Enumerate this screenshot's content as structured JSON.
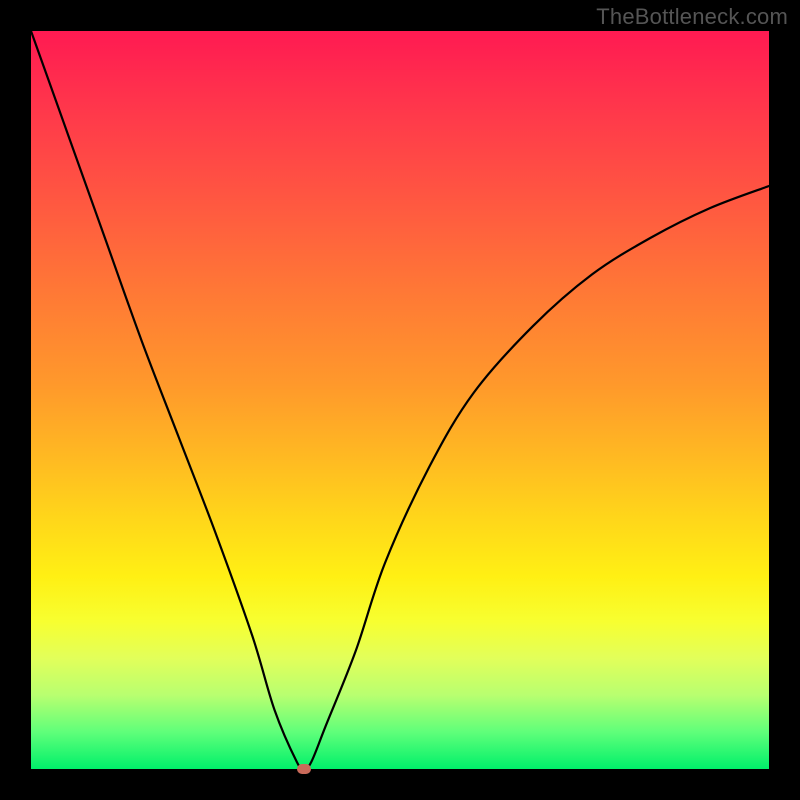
{
  "watermark": "TheBottleneck.com",
  "chart_data": {
    "type": "line",
    "title": "",
    "xlabel": "",
    "ylabel": "",
    "xlim": [
      0,
      100
    ],
    "ylim": [
      0,
      100
    ],
    "grid": false,
    "series": [
      {
        "name": "bottleneck-curve",
        "x": [
          0,
          5,
          10,
          15,
          20,
          25,
          30,
          33,
          36,
          37,
          38,
          40,
          44,
          48,
          54,
          60,
          68,
          76,
          84,
          92,
          100
        ],
        "values": [
          100,
          86,
          72,
          58,
          45,
          32,
          18,
          8,
          1,
          0,
          1,
          6,
          16,
          28,
          41,
          51,
          60,
          67,
          72,
          76,
          79
        ]
      }
    ],
    "min_point": {
      "x": 37,
      "y": 0
    },
    "colors": {
      "curve": "#000000",
      "marker": "#c96a5a",
      "gradient_top": "#ff1a52",
      "gradient_mid": "#ffd61a",
      "gradient_bottom": "#00f06a",
      "frame": "#000000"
    }
  }
}
